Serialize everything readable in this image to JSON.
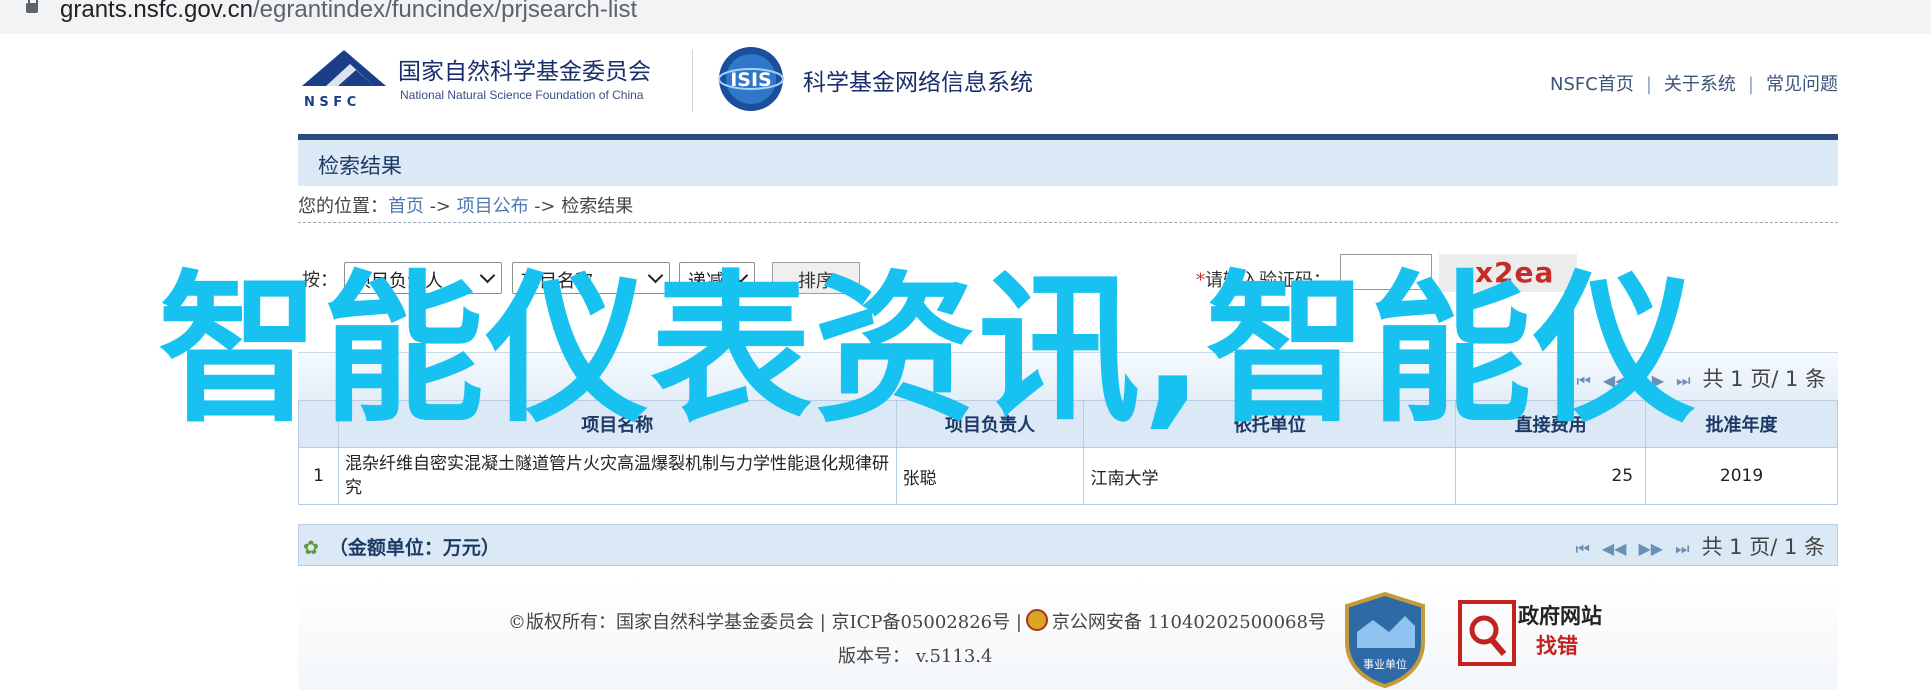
{
  "browser": {
    "host": "grants.nsfc.gov.cn",
    "path": "/egrantindex/funcindex/prjsearch-list"
  },
  "header": {
    "nsfc_cn": "国家自然科学基金委员会",
    "nsfc_en": "National Natural Science Foundation of China",
    "nsfc_abbr": "N S F C",
    "isis_logo": "ISIS",
    "isis_name": "科学基金网络信息系统",
    "links": [
      "NSFC首页",
      "关于系统",
      "常见问题"
    ]
  },
  "section_title": "检索结果",
  "breadcrumb": {
    "prefix": "您的位置：",
    "items": [
      "首页",
      "项目公布",
      "检索结果"
    ],
    "sep": " -> "
  },
  "filters": {
    "sort_label": "按：",
    "select1": "项目负责人",
    "select2": "项目名称",
    "select3": "递减",
    "sort_button": "排序",
    "captcha_required": "*",
    "captcha_label": "请输入验证码：",
    "captcha_text": "x2ea"
  },
  "pager": {
    "icons": [
      "first-page-icon",
      "prev-page-icon",
      "next-page-icon",
      "last-page-icon"
    ],
    "text": "共 1 页/ 1 条"
  },
  "table": {
    "headers": [
      "",
      "项目名称",
      "项目负责人",
      "依托单位",
      "直接费用",
      "批准年度"
    ],
    "rows": [
      [
        "1",
        "混杂纤维自密实混凝土隧道管片火灾高温爆裂机制与力学性能退化规律研究",
        "张聪",
        "江南大学",
        "25",
        "2019"
      ]
    ]
  },
  "unit_note": "（金额单位：万元）",
  "footer": {
    "copyright": "©版权所有：国家自然科学基金委员会 | 京ICP备05002826号 |",
    "beian": "京公网安备 11040202500068号",
    "version": "版本号：  v.5113.4",
    "shield_label": "事业单位",
    "gov_line1": "政府网站",
    "gov_line2": "找错"
  },
  "overlay_text": "智能仪表资讯,智能仪",
  "colors": {
    "navy": "#2d4c7e",
    "light_blue": "#dbe9f6",
    "link": "#4f77b0",
    "overlay": "#18c2f0"
  }
}
